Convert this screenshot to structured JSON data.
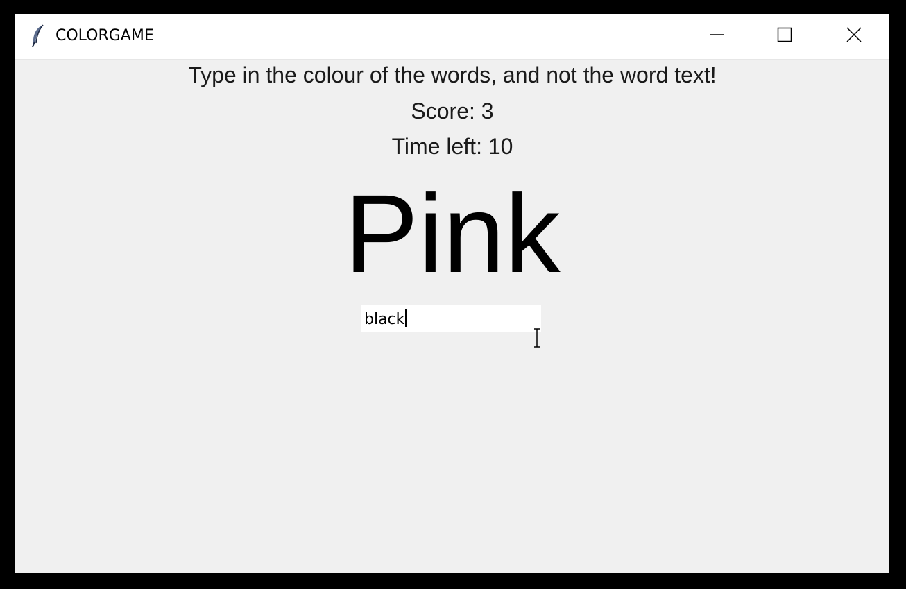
{
  "window": {
    "title": "COLORGAME",
    "app_icon": "feather-icon",
    "controls": {
      "minimize_icon": "minimize-icon",
      "maximize_icon": "maximize-icon",
      "close_icon": "close-icon"
    }
  },
  "game": {
    "instructions": "Type in the colour of the words, and not the word text!",
    "score": "Score: 3",
    "time_left": "Time left: 10",
    "colour_word": "Pink",
    "colour_word_color": "#000000"
  },
  "entry": {
    "value": "black"
  },
  "colors": {
    "window_background": "#f0f0f0",
    "titlebar_background": "#ffffff",
    "frame": "#000000"
  }
}
